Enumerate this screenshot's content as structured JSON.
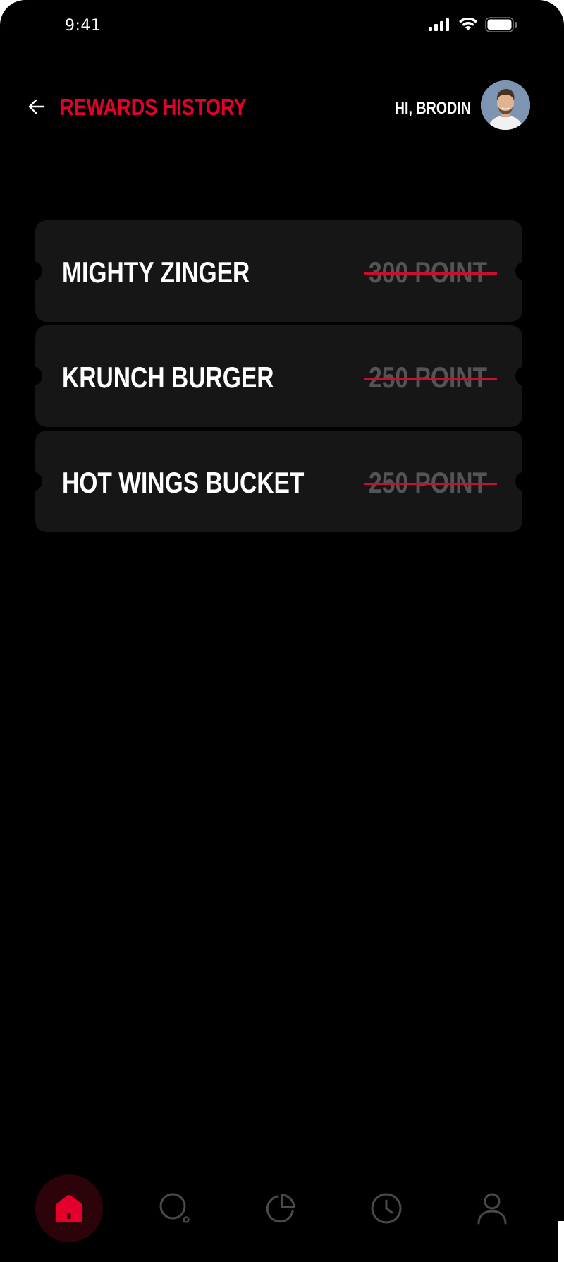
{
  "status_bar": {
    "time": "9:41",
    "icons": [
      "signal-icon",
      "wifi-icon",
      "battery-icon"
    ]
  },
  "header": {
    "back_icon": "arrow-left-icon",
    "title": "REWARDS HISTORY",
    "greeting": "HI, BRODIN",
    "avatar": "user-avatar"
  },
  "rewards": [
    {
      "name": "MIGHTY ZINGER",
      "points": "300 POINT"
    },
    {
      "name": "KRUNCH BURGER",
      "points": "250 POINT"
    },
    {
      "name": "HOT WINGS BUCKET",
      "points": "250 POINT"
    }
  ],
  "bottom_nav": {
    "items": [
      {
        "icon": "home-icon",
        "active": true
      },
      {
        "icon": "search-icon",
        "active": false
      },
      {
        "icon": "pie-chart-icon",
        "active": false
      },
      {
        "icon": "clock-icon",
        "active": false
      },
      {
        "icon": "profile-icon",
        "active": false
      }
    ]
  },
  "colors": {
    "accent": "#e4002b",
    "background": "#000000",
    "card": "#161616",
    "muted_text": "#545454"
  }
}
